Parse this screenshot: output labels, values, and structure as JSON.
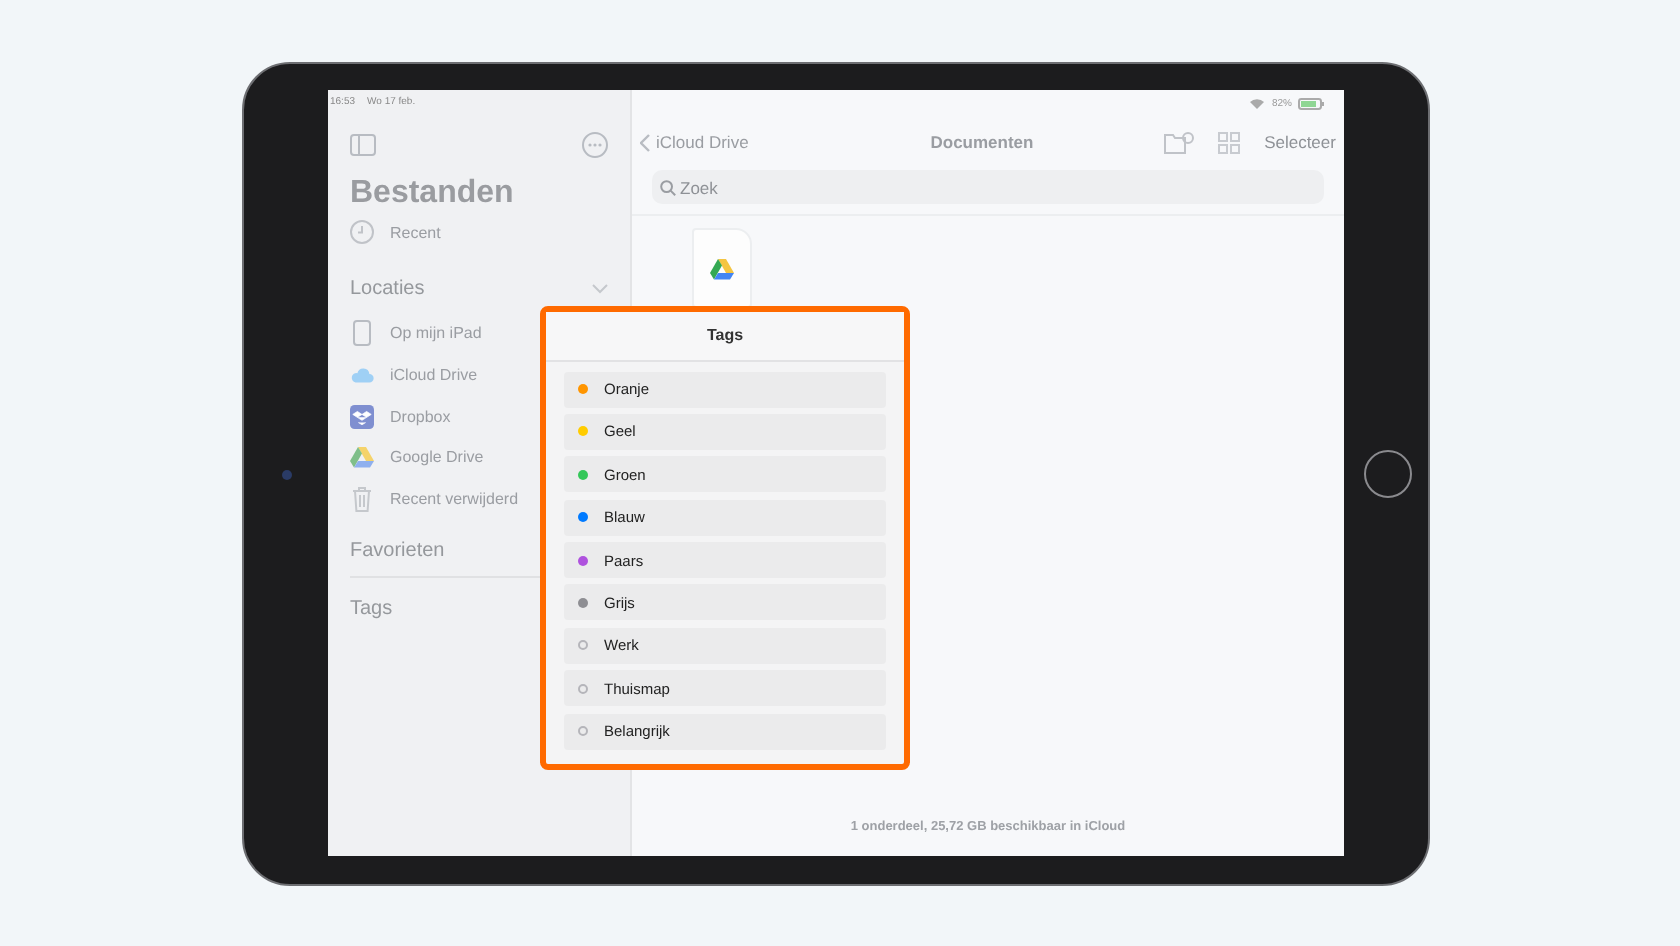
{
  "status_bar": {
    "time": "16:53",
    "date": "Wo 17 feb.",
    "battery": "82%"
  },
  "sidebar": {
    "title": "Bestanden",
    "recent": "Recent",
    "sections": [
      {
        "title": "Locaties",
        "expanded": true,
        "items": [
          {
            "kind": "ipad",
            "label": "Op mijn iPad"
          },
          {
            "kind": "icloud",
            "label": "iCloud Drive"
          },
          {
            "kind": "dropbox",
            "label": "Dropbox"
          },
          {
            "kind": "gdrive",
            "label": "Google Drive"
          },
          {
            "kind": "trash",
            "label": "Recent verwijderd"
          }
        ]
      },
      {
        "title": "Favorieten"
      },
      {
        "title": "Tags"
      }
    ]
  },
  "nav": {
    "back": "iCloud Drive",
    "title": "Documenten",
    "action": "Selecteer"
  },
  "search": {
    "placeholder": "Zoek"
  },
  "footer": "1 onderdeel, 25,72 GB beschikbaar in iCloud",
  "tags_popup": {
    "title": "Tags",
    "tags": [
      {
        "label": "Oranje",
        "kind": "filled",
        "color": "#ff9500"
      },
      {
        "label": "Geel",
        "kind": "filled",
        "color": "#ffcc00"
      },
      {
        "label": "Groen",
        "kind": "filled",
        "color": "#34c759"
      },
      {
        "label": "Blauw",
        "kind": "filled",
        "color": "#007aff"
      },
      {
        "label": "Paars",
        "kind": "filled",
        "color": "#af52de"
      },
      {
        "label": "Grijs",
        "kind": "filled",
        "color": "#8e8e93"
      },
      {
        "label": "Werk",
        "kind": "empty"
      },
      {
        "label": "Thuismap",
        "kind": "empty"
      },
      {
        "label": "Belangrijk",
        "kind": "empty"
      }
    ]
  }
}
